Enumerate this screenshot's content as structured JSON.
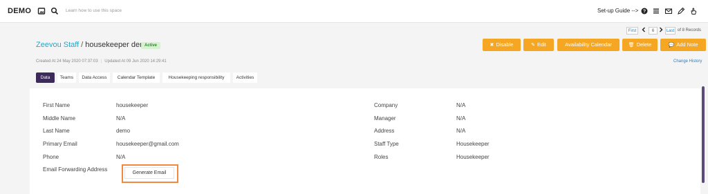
{
  "app": {
    "logo": "DEMO",
    "search_placeholder": "Learn how to use this space",
    "setup_guide": "Set-up Guide -->"
  },
  "record_nav": {
    "first": "First",
    "current": "6",
    "last": "Last",
    "of_records": "of 8 Records"
  },
  "breadcrumb": {
    "parent": "Zeevou Staff",
    "separator": "/",
    "current": "housekeeper demo",
    "status": "Active"
  },
  "actions": {
    "disable": "Disable",
    "edit": "Edit",
    "availability": "Availability Calendar",
    "delete": "Delete",
    "add_note": "Add Note"
  },
  "meta": {
    "created": "Created At 24 May 2020 07:37:03",
    "updated": "Updated At 09 Jun 2020 14:29:41",
    "change_history": "Change History"
  },
  "tabs": [
    "Data",
    "Teams",
    "Data Access",
    "Calendar Template",
    "Housekeeping responsibility",
    "Activities"
  ],
  "fields_left": [
    {
      "label": "First Name",
      "value": "housekeeper"
    },
    {
      "label": "Middle Name",
      "value": "N/A"
    },
    {
      "label": "Last Name",
      "value": "demo"
    },
    {
      "label": "Primary Email",
      "value": "housekeeper@gmail.com"
    },
    {
      "label": "Phone",
      "value": "N/A"
    },
    {
      "label": "Email Forwarding Address",
      "value": ""
    }
  ],
  "fields_right": [
    {
      "label": "Company",
      "value": "N/A"
    },
    {
      "label": "Manager",
      "value": "N/A"
    },
    {
      "label": "Address",
      "value": "N/A"
    },
    {
      "label": "Staff Type",
      "value": "Housekeeper"
    },
    {
      "label": "Roles",
      "value": "Housekeeper"
    }
  ],
  "generate_email": "Generate Email",
  "colors": {
    "accent": "#f5a623",
    "active_tab": "#3b2a5a",
    "link": "#26a7c9",
    "highlight": "#f0883e"
  }
}
